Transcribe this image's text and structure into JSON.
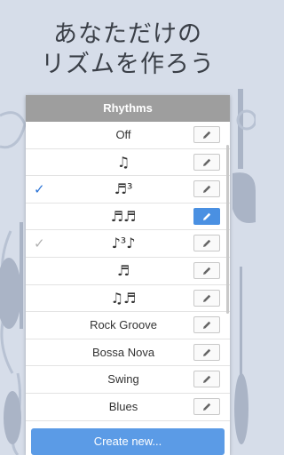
{
  "headline": {
    "line1": "あなただけの",
    "line2": "リズムを作ろう"
  },
  "panel": {
    "title": "Rhythms",
    "rows": [
      {
        "label": "Off",
        "kind": "text",
        "check": "none",
        "edit_active": false
      },
      {
        "label": "♫",
        "kind": "note",
        "check": "none",
        "edit_active": false
      },
      {
        "label": "♬³",
        "kind": "note",
        "check": "active",
        "edit_active": false
      },
      {
        "label": "♬♬",
        "kind": "note",
        "check": "none",
        "edit_active": true
      },
      {
        "label": "♪³♪",
        "kind": "note",
        "check": "inactive",
        "edit_active": false
      },
      {
        "label": "♬",
        "kind": "note",
        "check": "none",
        "edit_active": false
      },
      {
        "label": "♫♬",
        "kind": "note",
        "check": "none",
        "edit_active": false
      },
      {
        "label": "Rock Groove",
        "kind": "text",
        "check": "none",
        "edit_active": false
      },
      {
        "label": "Bossa Nova",
        "kind": "text",
        "check": "none",
        "edit_active": false
      },
      {
        "label": "Swing",
        "kind": "text",
        "check": "none",
        "edit_active": false
      },
      {
        "label": "Blues",
        "kind": "text",
        "check": "none",
        "edit_active": false
      }
    ],
    "check_glyph": "✓"
  },
  "create_button": {
    "label": "Create new..."
  },
  "colors": {
    "accent": "#4a90e2",
    "background": "#d6dde9",
    "header": "#9e9e9e"
  },
  "icons": {
    "edit": "pencil-icon",
    "check": "checkmark-icon"
  }
}
